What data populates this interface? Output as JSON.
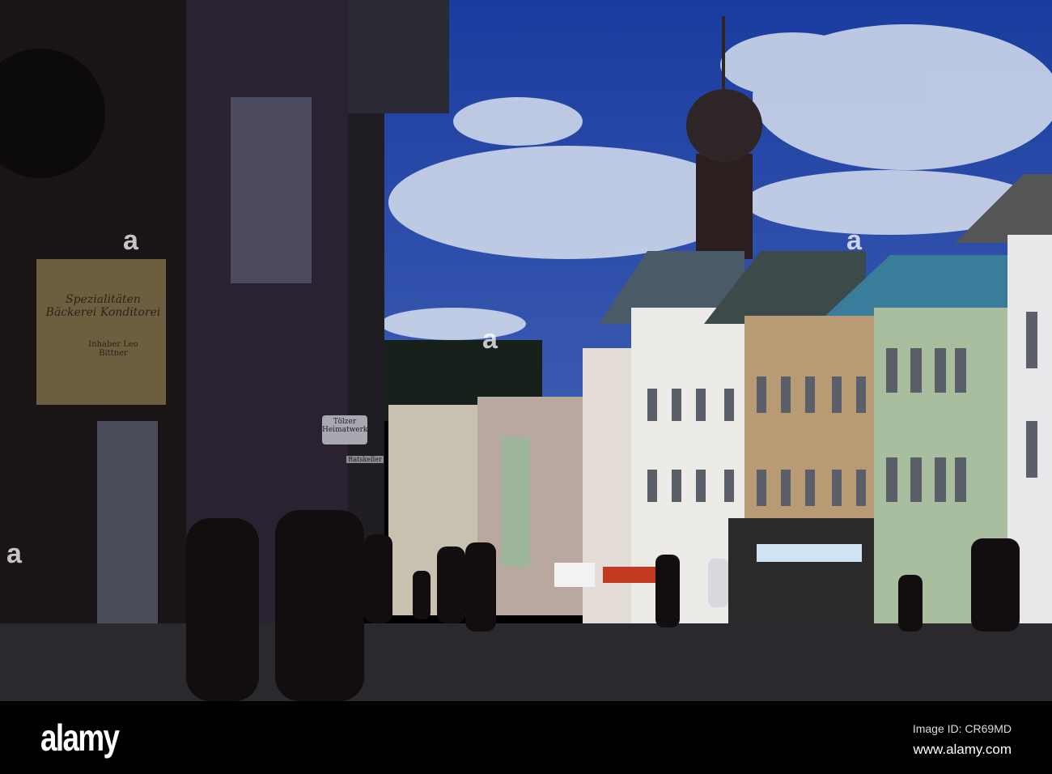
{
  "photo": {
    "shop_sign": "Spezialitäten Bäckerei Konditorei",
    "shop_owner": "Inhaber Leo Bittner",
    "hanging_sign_1": "Tölzer Heimatwerk",
    "hanging_sign_2": "Ratskeller",
    "watermark": "alamy"
  },
  "footer": {
    "logo": "alamy",
    "image_id": "Image ID: CR69MD",
    "url": "www.alamy.com"
  },
  "colors": {
    "sky": "#1f3f9a",
    "cloud": "#dfe6f2",
    "street": "#2a2a2e",
    "shadow": "#140f12"
  }
}
